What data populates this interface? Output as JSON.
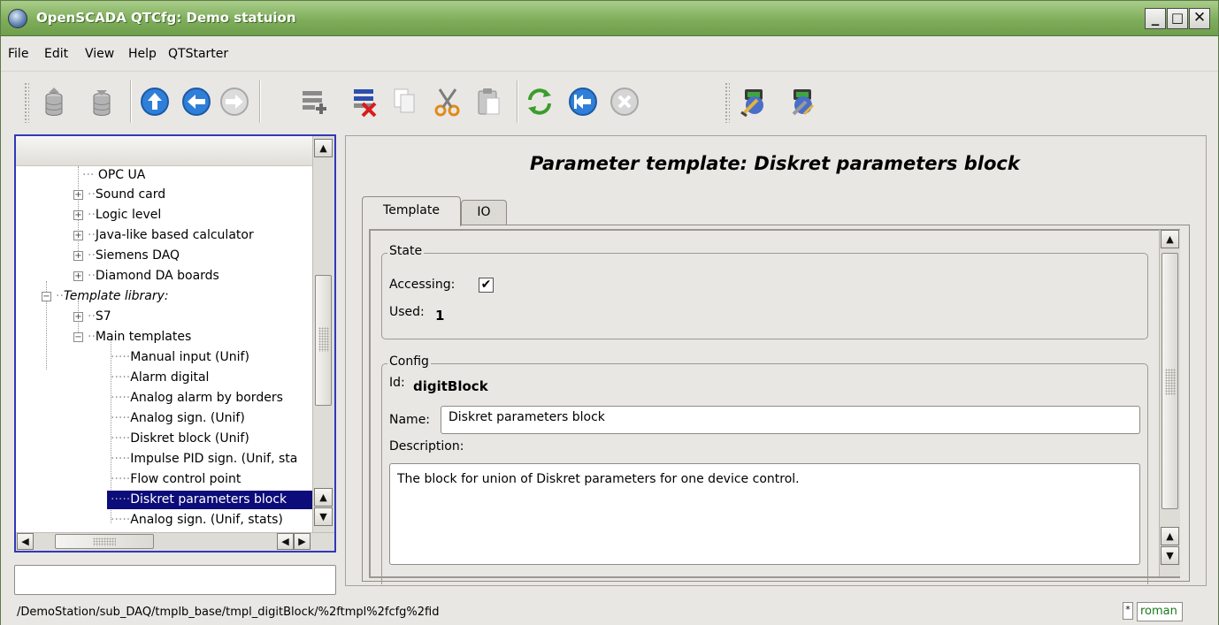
{
  "window": {
    "title": "OpenSCADA QTCfg: Demo statuion"
  },
  "menu": [
    {
      "label": "File"
    },
    {
      "label": "Edit"
    },
    {
      "label": "View"
    },
    {
      "label": "Help"
    },
    {
      "label": "QTStarter"
    }
  ],
  "toolbar": {
    "icons": [
      "db-load-icon",
      "db-save-icon",
      "up-icon",
      "back-icon",
      "forward-icon",
      "add-item-icon",
      "delete-item-icon",
      "copy-icon",
      "cut-icon",
      "paste-icon",
      "refresh-icon",
      "start-icon",
      "stop-icon",
      "remote-station-icon",
      "station-config-icon"
    ]
  },
  "tree": {
    "items": [
      {
        "label": "OPC UA"
      },
      {
        "label": "Sound card"
      },
      {
        "label": "Logic level"
      },
      {
        "label": "Java-like based calculator"
      },
      {
        "label": "Siemens DAQ"
      },
      {
        "label": "Diamond DA boards"
      },
      {
        "label": "Template library:"
      },
      {
        "label": "S7"
      },
      {
        "label": "Main templates"
      },
      {
        "label": "Manual input (Unif)"
      },
      {
        "label": "Alarm digital"
      },
      {
        "label": "Analog alarm by borders"
      },
      {
        "label": "Analog sign. (Unif)"
      },
      {
        "label": "Diskret block (Unif)"
      },
      {
        "label": "Impulse PID sign. (Unif, sta"
      },
      {
        "label": "Flow control point"
      },
      {
        "label": "Diskret parameters block"
      },
      {
        "label": "Analog sign. (Unif, stats)"
      }
    ]
  },
  "main": {
    "page_title": "Parameter template: Diskret parameters block",
    "tabs": [
      {
        "label": "Template"
      },
      {
        "label": "IO"
      }
    ],
    "state": {
      "title": "State",
      "accessing_label": "Accessing:",
      "accessing_checked": "✔",
      "used_label": "Used:",
      "used_value": "1"
    },
    "config": {
      "title": "Config",
      "id_label": "Id:",
      "id_value": "digitBlock",
      "name_label": "Name:",
      "name_value": "Diskret parameters block",
      "description_label": "Description:",
      "description_value": "The block for union of Diskret parameters for one device control."
    }
  },
  "status": {
    "path": "/DemoStation/sub_DAQ/tmplb_base/tmpl_digitBlock/%2ftmpl%2fcfg%2fid",
    "indicator": "*",
    "user": "roman"
  }
}
